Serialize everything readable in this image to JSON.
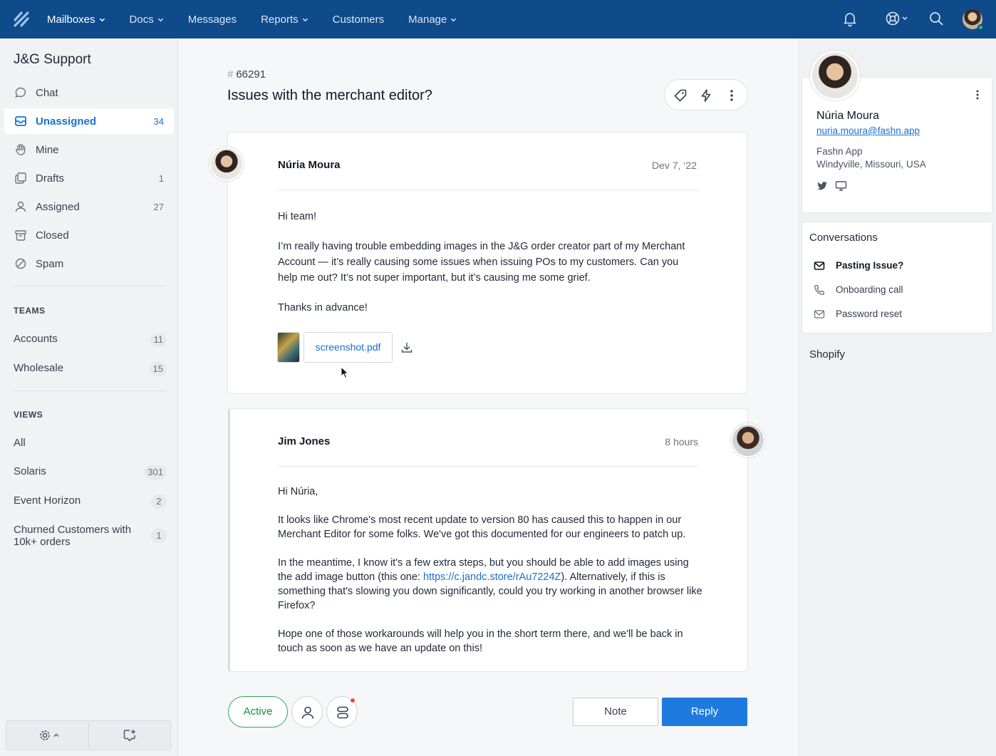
{
  "nav": {
    "items": [
      {
        "label": "Mailboxes",
        "dropdown": true,
        "active": true
      },
      {
        "label": "Docs",
        "dropdown": true
      },
      {
        "label": "Messages",
        "dropdown": false
      },
      {
        "label": "Reports",
        "dropdown": true
      },
      {
        "label": "Customers",
        "dropdown": false
      },
      {
        "label": "Manage",
        "dropdown": true
      }
    ],
    "icons": [
      "logo-icon",
      "bell-icon",
      "help-icon",
      "search-icon",
      "avatar"
    ],
    "brand_color": "#0f4a8a"
  },
  "sidebar": {
    "title": "J&G Support",
    "items": [
      {
        "label": "Chat",
        "count": "",
        "icon": "chat-bubble-icon"
      },
      {
        "label": "Unassigned",
        "count": "34",
        "icon": "inbox-icon",
        "active": true
      },
      {
        "label": "Mine",
        "count": "",
        "icon": "hand-icon"
      },
      {
        "label": "Drafts",
        "count": "1",
        "icon": "drafts-icon"
      },
      {
        "label": "Assigned",
        "count": "27",
        "icon": "person-icon"
      },
      {
        "label": "Closed",
        "count": "",
        "icon": "archive-icon"
      },
      {
        "label": "Spam",
        "count": "",
        "icon": "ban-icon"
      }
    ],
    "teams_heading": "TEAMS",
    "teams": [
      {
        "label": "Accounts",
        "count": "11"
      },
      {
        "label": "Wholesale",
        "count": "15"
      }
    ],
    "views_heading": "VIEWS",
    "views": [
      {
        "label": "All",
        "count": ""
      },
      {
        "label": "Solaris",
        "count": "301"
      },
      {
        "label": "Event Horizon",
        "count": "2"
      },
      {
        "label": "Churned Customers with 10k+ orders",
        "count": "1"
      }
    ]
  },
  "ticket": {
    "hash": "#",
    "number": "66291",
    "title": "Issues with the merchant editor?"
  },
  "messages": [
    {
      "author": "Núria Moura",
      "date": "Dev 7, ‘22",
      "paragraphs": [
        "Hi team!",
        "I’m really having trouble embedding images in the J&G order creator part of my Merchant Account — it’s really causing some issues when issuing POs to my customers. Can you help me out? It’s not super important, but it’s causing me some grief.",
        "Thanks in advance!"
      ],
      "attachment": "screenshot.pdf"
    },
    {
      "author": "Jim Jones",
      "date": "8 hours",
      "p1": "Hi Núria,",
      "p2": "It looks like Chrome's most recent update to version 80 has caused this to happen in our Merchant Editor for some folks. We've got this documented for our engineers to patch up.",
      "p3_before": "In the meantime, I know it's a few extra steps, but you should be able to add images using the add image button (this one: ",
      "p3_link": "https://c.jandc.store/rAu7224Z",
      "p3_after": "). Alternatively, if this is something that's slowing you down significantly, could you try working in another browser like Firefox?",
      "p4": "Hope one of those workarounds will help you in the short term there, and we'll be back in touch as soon as we have an update on this!"
    }
  ],
  "actions": {
    "status": "Active",
    "note": "Note",
    "reply": "Reply",
    "status_color": "#31a65a",
    "reply_color": "#1f7ae0"
  },
  "customer": {
    "name": "Núria Moura",
    "email": "nuria.moura@fashn.app",
    "company": "Fashn App",
    "location": "Windyville, Missouri, USA",
    "conversations_title": "Conversations",
    "conversations": [
      {
        "label": "Pasting Issue?",
        "icon": "envelope-icon",
        "current": true
      },
      {
        "label": "Onboarding call",
        "icon": "phone-icon"
      },
      {
        "label": "Password reset",
        "icon": "envelope-icon"
      }
    ],
    "shopify_title": "Shopify"
  }
}
